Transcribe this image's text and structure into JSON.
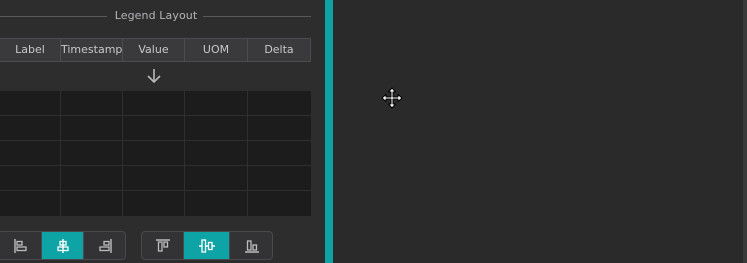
{
  "legend_layout": {
    "title": "Legend Layout",
    "columns": [
      "Label",
      "Timestamp",
      "Value",
      "UOM",
      "Delta"
    ]
  },
  "horizontal_align": {
    "buttons": [
      {
        "name": "align-left",
        "active": false
      },
      {
        "name": "align-center",
        "active": true
      },
      {
        "name": "align-right",
        "active": false
      }
    ]
  },
  "vertical_align": {
    "buttons": [
      {
        "name": "align-top",
        "active": false
      },
      {
        "name": "align-middle",
        "active": true
      },
      {
        "name": "align-bottom",
        "active": false
      }
    ]
  },
  "colors": {
    "accent": "#0ea3a5",
    "panel": "#2d2d2e",
    "grid": "#1c1c1d"
  },
  "icons": {
    "drop": "arrow-down-icon",
    "cursor": "move-cursor-icon"
  }
}
